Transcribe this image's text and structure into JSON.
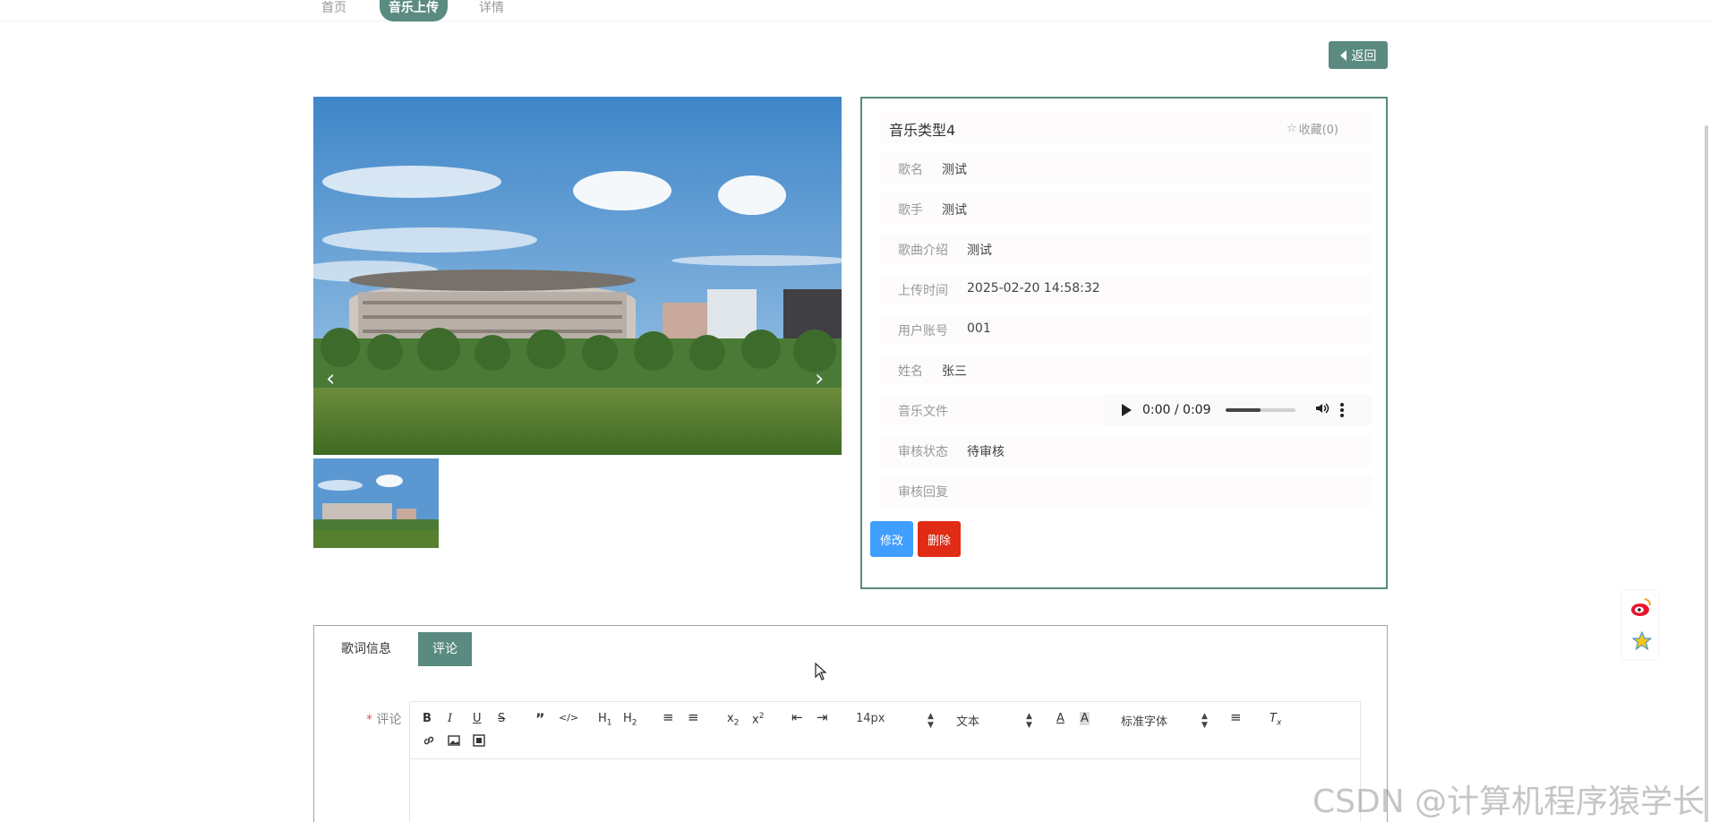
{
  "nav": {
    "items": [
      {
        "label": "首页",
        "active": false
      },
      {
        "label": "音乐上传",
        "active": true
      },
      {
        "label": "详情",
        "active": false
      }
    ]
  },
  "back_label": "返回",
  "detail": {
    "title": "音乐类型4",
    "favorite_label": "收藏(0)",
    "fields": [
      {
        "label": "歌名",
        "value": "测试"
      },
      {
        "label": "歌手",
        "value": "测试"
      },
      {
        "label": "歌曲介绍",
        "value": "测试"
      },
      {
        "label": "上传时间",
        "value": "2025-02-20 14:58:32"
      },
      {
        "label": "用户账号",
        "value": "001"
      },
      {
        "label": "姓名",
        "value": "张三"
      },
      {
        "label": "音乐文件",
        "value": ""
      },
      {
        "label": "审核状态",
        "value": "待审核"
      },
      {
        "label": "审核回复",
        "value": ""
      }
    ],
    "audio": {
      "time": "0:00 / 0:09",
      "progress": 0.5
    },
    "edit_label": "修改",
    "delete_label": "删除"
  },
  "tabs": [
    {
      "label": "歌词信息",
      "active": false
    },
    {
      "label": "评论",
      "active": true
    }
  ],
  "comment": {
    "label": "评论",
    "required_mark": "*",
    "toolbar": {
      "font_size": "14px",
      "paragraph": "文本",
      "font_family": "标准字体"
    }
  },
  "watermark": "CSDN @计算机程序猿学长",
  "colors": {
    "accent": "#5a8a80",
    "edit": "#409eff",
    "delete": "#e02b15"
  }
}
